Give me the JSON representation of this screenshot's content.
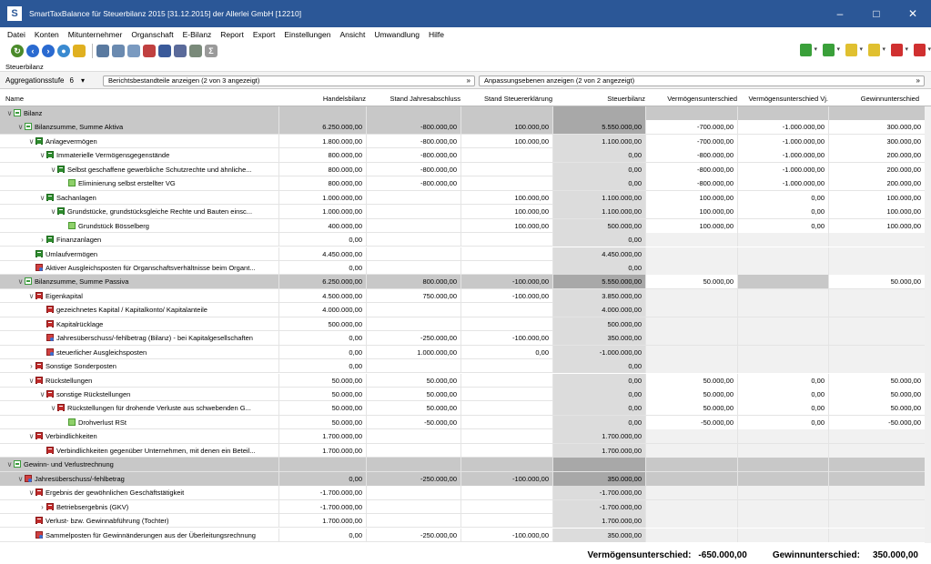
{
  "window": {
    "title": "SmartTaxBalance für Steuerbilanz 2015 [31.12.2015] der Allerlei GmbH [12210]",
    "minimize": "–",
    "maximize": "□",
    "close": "✕"
  },
  "menu": [
    "Datei",
    "Konten",
    "Mitunternehmer",
    "Organschaft",
    "E-Bilanz",
    "Report",
    "Export",
    "Einstellungen",
    "Ansicht",
    "Umwandlung",
    "Hilfe"
  ],
  "toolbar": {
    "left_icons": [
      "refresh-icon",
      "back-icon",
      "forward-icon",
      "globe-icon",
      "flag-icon",
      "print-icon",
      "print-preview-icon",
      "print-setup-icon",
      "export-icon",
      "book-icon",
      "columns-icon",
      "clipboard-icon",
      "formula-icon"
    ],
    "right_icons": [
      "green-cube-icon",
      "green-cube-icon",
      "yellow-cube-icon",
      "yellow-cube-icon",
      "red-cube-icon",
      "red-cube-icon"
    ]
  },
  "section_label": "Steuerbilanz",
  "filter": {
    "agg_label": "Aggregationsstufe",
    "agg_value": "6",
    "agg_dropdown": "▾",
    "berichts_text": "Berichtsbestandteile anzeigen (2 von 3 angezeigt)",
    "anpassung_text": "Anpassungsebenen anzeigen (2 von 2 angezeigt)",
    "chevron": "»"
  },
  "columns": [
    "Name",
    "Handelsbilanz",
    "Stand Jahresabschluss",
    "Stand Steuererklärung",
    "Steuerbilanz",
    "Vermögensunterschied",
    "Vermögensunterschied Vj.",
    "Gewinnunterschied"
  ],
  "rows": [
    {
      "level": 0,
      "toggle": "∨",
      "icon": "folder",
      "gray": true,
      "name": "Bilanz",
      "hb": "",
      "sj": "",
      "se": "",
      "sb": "",
      "vu": "",
      "vuvj": "",
      "gu": ""
    },
    {
      "level": 1,
      "toggle": "∨",
      "icon": "folder",
      "gray": true,
      "name": "Bilanzsumme, Summe Aktiva",
      "hb": "6.250.000,00",
      "sj": "-800.000,00",
      "se": "100.000,00",
      "sb": "5.550.000,00",
      "vu": "-700.000,00",
      "vuvj": "-1.000.000,00",
      "gu": "300.000,00"
    },
    {
      "level": 2,
      "toggle": "∨",
      "icon": "green",
      "gray": false,
      "name": "Anlagevermögen",
      "hb": "1.800.000,00",
      "sj": "-800.000,00",
      "se": "100.000,00",
      "sb": "1.100.000,00",
      "vu": "-700.000,00",
      "vuvj": "-1.000.000,00",
      "gu": "300.000,00"
    },
    {
      "level": 3,
      "toggle": "∨",
      "icon": "green",
      "gray": false,
      "name": "Immaterielle Vermögensgegenstände",
      "hb": "800.000,00",
      "sj": "-800.000,00",
      "se": "",
      "sb": "0,00",
      "vu": "-800.000,00",
      "vuvj": "-1.000.000,00",
      "gu": "200.000,00"
    },
    {
      "level": 4,
      "toggle": "∨",
      "icon": "green",
      "gray": false,
      "name": "Selbst geschaffene gewerbliche Schutzrechte und ähnliche...",
      "hb": "800.000,00",
      "sj": "-800.000,00",
      "se": "",
      "sb": "0,00",
      "vu": "-800.000,00",
      "vuvj": "-1.000.000,00",
      "gu": "200.000,00"
    },
    {
      "level": 5,
      "toggle": "",
      "icon": "leaf",
      "gray": false,
      "name": "Eliminierung selbst erstellter VG",
      "hb": "800.000,00",
      "sj": "-800.000,00",
      "se": "",
      "sb": "0,00",
      "vu": "-800.000,00",
      "vuvj": "-1.000.000,00",
      "gu": "200.000,00"
    },
    {
      "level": 3,
      "toggle": "∨",
      "icon": "green",
      "gray": false,
      "name": "Sachanlagen",
      "hb": "1.000.000,00",
      "sj": "",
      "se": "100.000,00",
      "sb": "1.100.000,00",
      "vu": "100.000,00",
      "vuvj": "0,00",
      "gu": "100.000,00"
    },
    {
      "level": 4,
      "toggle": "∨",
      "icon": "green",
      "gray": false,
      "name": "Grundstücke, grundstücksgleiche Rechte und Bauten einsc...",
      "hb": "1.000.000,00",
      "sj": "",
      "se": "100.000,00",
      "sb": "1.100.000,00",
      "vu": "100.000,00",
      "vuvj": "0,00",
      "gu": "100.000,00"
    },
    {
      "level": 5,
      "toggle": "",
      "icon": "leaf",
      "gray": false,
      "name": "Grundstück Bösselberg",
      "hb": "400.000,00",
      "sj": "",
      "se": "100.000,00",
      "sb": "500.000,00",
      "vu": "100.000,00",
      "vuvj": "0,00",
      "gu": "100.000,00"
    },
    {
      "level": 3,
      "toggle": "›",
      "icon": "green",
      "gray": false,
      "name": "Finanzanlagen",
      "hb": "0,00",
      "sj": "",
      "se": "",
      "sb": "0,00",
      "vu": "",
      "vuvj": "",
      "gu": ""
    },
    {
      "level": 2,
      "toggle": "",
      "icon": "green",
      "gray": false,
      "name": "Umlaufvermögen",
      "hb": "4.450.000,00",
      "sj": "",
      "se": "",
      "sb": "4.450.000,00",
      "vu": "",
      "vuvj": "",
      "gu": ""
    },
    {
      "level": 2,
      "toggle": "",
      "icon": "pos",
      "gray": false,
      "name": "Aktiver Ausgleichsposten für Organschaftsverhältnisse beim Organt...",
      "hb": "0,00",
      "sj": "",
      "se": "",
      "sb": "0,00",
      "vu": "",
      "vuvj": "",
      "gu": ""
    },
    {
      "level": 1,
      "toggle": "∨",
      "icon": "folder",
      "gray": true,
      "name": "Bilanzsumme, Summe Passiva",
      "hb": "6.250.000,00",
      "sj": "800.000,00",
      "se": "-100.000,00",
      "sb": "5.550.000,00",
      "vu": "50.000,00",
      "vuvj": "",
      "gu": "50.000,00"
    },
    {
      "level": 2,
      "toggle": "∨",
      "icon": "red",
      "gray": false,
      "name": "Eigenkapital",
      "hb": "4.500.000,00",
      "sj": "750.000,00",
      "se": "-100.000,00",
      "sb": "3.850.000,00",
      "vu": "",
      "vuvj": "",
      "gu": ""
    },
    {
      "level": 3,
      "toggle": "",
      "icon": "red",
      "gray": false,
      "name": "gezeichnetes Kapital / Kapitalkonto/ Kapitalanteile",
      "hb": "4.000.000,00",
      "sj": "",
      "se": "",
      "sb": "4.000.000,00",
      "vu": "",
      "vuvj": "",
      "gu": ""
    },
    {
      "level": 3,
      "toggle": "",
      "icon": "red",
      "gray": false,
      "name": "Kapitalrücklage",
      "hb": "500.000,00",
      "sj": "",
      "se": "",
      "sb": "500.000,00",
      "vu": "",
      "vuvj": "",
      "gu": ""
    },
    {
      "level": 3,
      "toggle": "",
      "icon": "pos",
      "gray": false,
      "name": "Jahresüberschuss/-fehlbetrag (Bilanz) - bei Kapitalgesellschaften",
      "hb": "0,00",
      "sj": "-250.000,00",
      "se": "-100.000,00",
      "sb": "350.000,00",
      "vu": "",
      "vuvj": "",
      "gu": ""
    },
    {
      "level": 3,
      "toggle": "",
      "icon": "pos",
      "gray": false,
      "name": "steuerlicher Ausgleichsposten",
      "hb": "0,00",
      "sj": "1.000.000,00",
      "se": "0,00",
      "sb": "-1.000.000,00",
      "vu": "",
      "vuvj": "",
      "gu": ""
    },
    {
      "level": 2,
      "toggle": "›",
      "icon": "red",
      "gray": false,
      "name": "Sonstige Sonderposten",
      "hb": "0,00",
      "sj": "",
      "se": "",
      "sb": "0,00",
      "vu": "",
      "vuvj": "",
      "gu": ""
    },
    {
      "level": 2,
      "toggle": "∨",
      "icon": "red",
      "gray": false,
      "name": "Rückstellungen",
      "hb": "50.000,00",
      "sj": "50.000,00",
      "se": "",
      "sb": "0,00",
      "vu": "50.000,00",
      "vuvj": "0,00",
      "gu": "50.000,00"
    },
    {
      "level": 3,
      "toggle": "∨",
      "icon": "red",
      "gray": false,
      "name": "sonstige Rückstellungen",
      "hb": "50.000,00",
      "sj": "50.000,00",
      "se": "",
      "sb": "0,00",
      "vu": "50.000,00",
      "vuvj": "0,00",
      "gu": "50.000,00"
    },
    {
      "level": 4,
      "toggle": "∨",
      "icon": "red",
      "gray": false,
      "name": "Rückstellungen für drohende Verluste aus schwebenden G...",
      "hb": "50.000,00",
      "sj": "50.000,00",
      "se": "",
      "sb": "0,00",
      "vu": "50.000,00",
      "vuvj": "0,00",
      "gu": "50.000,00"
    },
    {
      "level": 5,
      "toggle": "",
      "icon": "leaf",
      "gray": false,
      "name": "Drohverlust RSt",
      "hb": "50.000,00",
      "sj": "-50.000,00",
      "se": "",
      "sb": "0,00",
      "vu": "-50.000,00",
      "vuvj": "0,00",
      "gu": "-50.000,00"
    },
    {
      "level": 2,
      "toggle": "∨",
      "icon": "red",
      "gray": false,
      "name": "Verbindlichkeiten",
      "hb": "1.700.000,00",
      "sj": "",
      "se": "",
      "sb": "1.700.000,00",
      "vu": "",
      "vuvj": "",
      "gu": ""
    },
    {
      "level": 3,
      "toggle": "",
      "icon": "red",
      "gray": false,
      "name": "Verbindlichkeiten gegenüber Unternehmen, mit denen ein Beteil...",
      "hb": "1.700.000,00",
      "sj": "",
      "se": "",
      "sb": "1.700.000,00",
      "vu": "",
      "vuvj": "",
      "gu": ""
    },
    {
      "level": 0,
      "toggle": "∨",
      "icon": "folder",
      "gray": true,
      "name": "Gewinn- und Verlustrechnung",
      "hb": "",
      "sj": "",
      "se": "",
      "sb": "",
      "vu": "",
      "vuvj": "",
      "gu": ""
    },
    {
      "level": 1,
      "toggle": "∨",
      "icon": "pos",
      "gray": true,
      "name": "Jahresüberschuss/-fehlbetrag",
      "hb": "0,00",
      "sj": "-250.000,00",
      "se": "-100.000,00",
      "sb": "350.000,00",
      "vu": "",
      "vuvj": "",
      "gu": ""
    },
    {
      "level": 2,
      "toggle": "∨",
      "icon": "red",
      "gray": false,
      "name": "Ergebnis der gewöhnlichen Geschäftstätigkeit",
      "hb": "-1.700.000,00",
      "sj": "",
      "se": "",
      "sb": "-1.700.000,00",
      "vu": "",
      "vuvj": "",
      "gu": ""
    },
    {
      "level": 3,
      "toggle": "›",
      "icon": "red",
      "gray": false,
      "name": "Betriebsergebnis (GKV)",
      "hb": "-1.700.000,00",
      "sj": "",
      "se": "",
      "sb": "-1.700.000,00",
      "vu": "",
      "vuvj": "",
      "gu": ""
    },
    {
      "level": 2,
      "toggle": "",
      "icon": "red",
      "gray": false,
      "name": "Verlust- bzw. Gewinnabführung (Tochter)",
      "hb": "1.700.000,00",
      "sj": "",
      "se": "",
      "sb": "1.700.000,00",
      "vu": "",
      "vuvj": "",
      "gu": ""
    },
    {
      "level": 2,
      "toggle": "",
      "icon": "pos",
      "gray": false,
      "name": "Sammelposten für Gewinnänderungen aus der Überleitungsrechnung",
      "hb": "0,00",
      "sj": "-250.000,00",
      "se": "-100.000,00",
      "sb": "350.000,00",
      "vu": "",
      "vuvj": "",
      "gu": ""
    }
  ],
  "footer": {
    "vu_label": "Vermögensunterschied:",
    "vu_value": "-650.000,00",
    "gu_label": "Gewinnunterschied:",
    "gu_value": "350.000,00"
  },
  "colors": {
    "titlebar": "#2b5797",
    "row_gray": "#c8c8c8",
    "steuerbilanz_col": "#dcdcdc"
  }
}
